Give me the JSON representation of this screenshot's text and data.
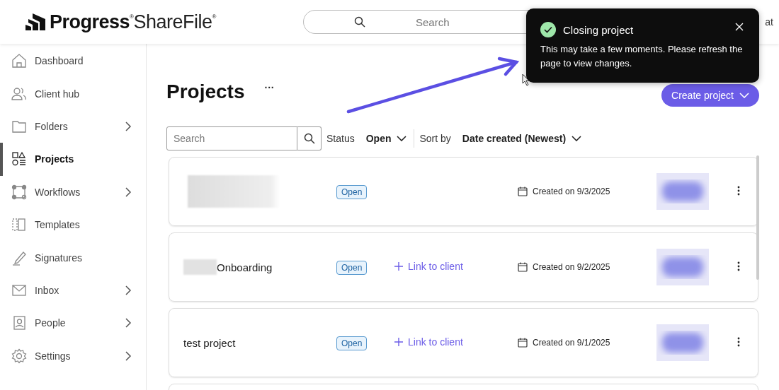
{
  "header": {
    "logo": "**Progress**$^{®}$ShareFile$^{®}$",
    "search": {
      "placeholder": "Search"
    },
    "partial_link": "at"
  },
  "sidebar": {
    "items": [
      {
        "label": "Dashboard",
        "selected": false,
        "expandable": false
      },
      {
        "label": "Client hub",
        "selected": false,
        "expandable": false
      },
      {
        "label": "Folders",
        "selected": false,
        "expandable": true
      },
      {
        "label": "Projects",
        "selected": true,
        "expandable": false
      },
      {
        "label": "Workflows",
        "selected": false,
        "expandable": true
      },
      {
        "label": "Templates",
        "selected": false,
        "expandable": false
      },
      {
        "label": "Signatures",
        "selected": false,
        "expandable": false
      },
      {
        "label": "Inbox",
        "selected": false,
        "expandable": true
      },
      {
        "label": "People",
        "selected": false,
        "expandable": true
      },
      {
        "label": "Settings",
        "selected": false,
        "expandable": true
      }
    ]
  },
  "page": {
    "title": "Projects",
    "more": "···",
    "create_button": "Create project"
  },
  "filters": {
    "search": {
      "placeholder": "Search"
    },
    "status_label": "Status",
    "status_value": "Open",
    "sort_label": "Sort by",
    "sort_value": "Date created (Newest)"
  },
  "projects": [
    {
      "redacted": true,
      "status": "Open",
      "created": "Created on 9/3/2025"
    },
    {
      "redacted": true,
      "name": "Onboarding",
      "status": "Open",
      "link": "Link to client",
      "created": "Created on 9/2/2025"
    },
    {
      "redacted": false,
      "name": "test project",
      "status": "Open",
      "link": "Link to client",
      "created": "Created on 9/1/2025"
    }
  ],
  "toast": {
    "title": "Closing project",
    "message": "This may take a few moments. Please refresh the page to view changes."
  }
}
